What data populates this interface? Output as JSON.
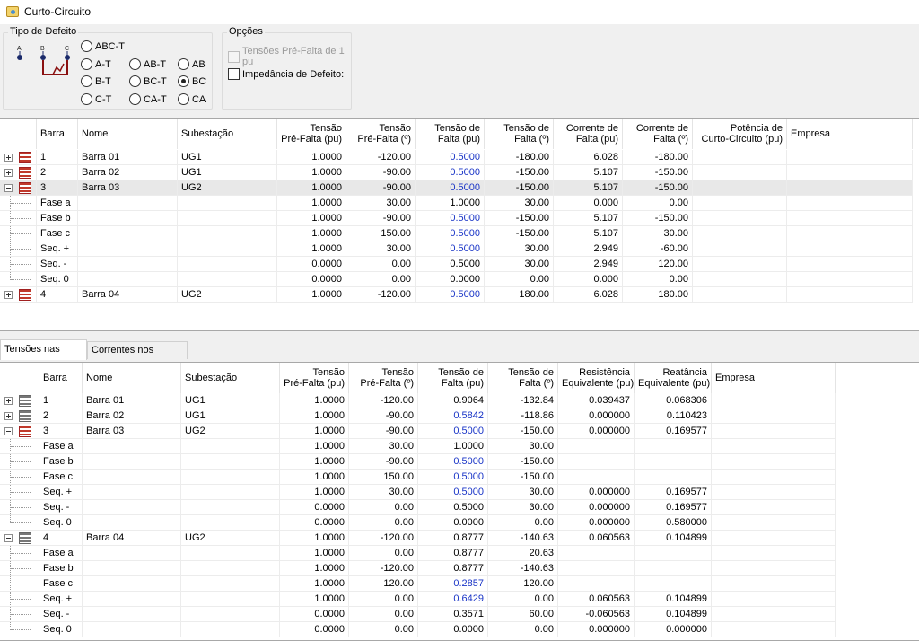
{
  "window": {
    "title": "Curto-Circuito"
  },
  "tipo_defeito": {
    "title": "Tipo de Defeito",
    "diagram_labels": [
      "A",
      "B",
      "C"
    ],
    "options": [
      {
        "label": "ABC-T",
        "checked": false
      },
      {
        "label": "A-T",
        "checked": false
      },
      {
        "label": "AB-T",
        "checked": false
      },
      {
        "label": "AB",
        "checked": false
      },
      {
        "label": "B-T",
        "checked": false
      },
      {
        "label": "BC-T",
        "checked": false
      },
      {
        "label": "BC",
        "checked": true
      },
      {
        "label": "C-T",
        "checked": false
      },
      {
        "label": "CA-T",
        "checked": false
      },
      {
        "label": "CA",
        "checked": false
      }
    ]
  },
  "opcoes": {
    "title": "Opções",
    "tensoes_prefalta": {
      "label": "Tensões Pré-Falta de 1 pu",
      "checked": false,
      "enabled": false
    },
    "impedancia": {
      "label": "Impedância de Defeito:",
      "checked": false,
      "enabled": true
    }
  },
  "grid1": {
    "headers": [
      [
        "",
        ""
      ],
      [
        "",
        "Barra"
      ],
      [
        "",
        "Nome"
      ],
      [
        "",
        "Subestação"
      ],
      [
        "Tensão",
        "Pré-Falta (pu)"
      ],
      [
        "Tensão",
        "Pré-Falta (º)"
      ],
      [
        "Tensão de",
        "Falta (pu)"
      ],
      [
        "Tensão de",
        "Falta (º)"
      ],
      [
        "Corrente de",
        "Falta (pu)"
      ],
      [
        "Corrente de",
        "Falta (º)"
      ],
      [
        "Potência de",
        "Curto-Circuito (pu)"
      ],
      [
        "",
        "Empresa"
      ]
    ],
    "rows": [
      {
        "type": "bus",
        "expander": "plus",
        "icon": "red",
        "cells": [
          "1",
          "Barra 01",
          "UG1",
          "1.0000",
          "-120.00",
          "0.5000",
          "-180.00",
          "6.028",
          "-180.00",
          "",
          ""
        ],
        "blue": [
          5
        ]
      },
      {
        "type": "bus",
        "expander": "plus",
        "icon": "red",
        "cells": [
          "2",
          "Barra 02",
          "UG1",
          "1.0000",
          "-90.00",
          "0.5000",
          "-150.00",
          "5.107",
          "-150.00",
          "",
          ""
        ],
        "blue": [
          5
        ]
      },
      {
        "type": "bus",
        "expander": "minus",
        "icon": "red",
        "selected": true,
        "cells": [
          "3",
          "Barra 03",
          "UG2",
          "1.0000",
          "-90.00",
          "0.5000",
          "-150.00",
          "5.107",
          "-150.00",
          "",
          ""
        ],
        "blue": [
          5
        ]
      },
      {
        "type": "child",
        "cells": [
          "Fase a",
          "",
          "",
          "1.0000",
          "30.00",
          "1.0000",
          "30.00",
          "0.000",
          "0.00",
          "",
          ""
        ],
        "blue": []
      },
      {
        "type": "child",
        "cells": [
          "Fase b",
          "",
          "",
          "1.0000",
          "-90.00",
          "0.5000",
          "-150.00",
          "5.107",
          "-150.00",
          "",
          ""
        ],
        "blue": [
          5
        ]
      },
      {
        "type": "child",
        "cells": [
          "Fase c",
          "",
          "",
          "1.0000",
          "150.00",
          "0.5000",
          "-150.00",
          "5.107",
          "30.00",
          "",
          ""
        ],
        "blue": [
          5
        ]
      },
      {
        "type": "child",
        "cells": [
          "Seq. +",
          "",
          "",
          "1.0000",
          "30.00",
          "0.5000",
          "30.00",
          "2.949",
          "-60.00",
          "",
          ""
        ],
        "blue": [
          5
        ]
      },
      {
        "type": "child",
        "cells": [
          "Seq. -",
          "",
          "",
          "0.0000",
          "0.00",
          "0.5000",
          "30.00",
          "2.949",
          "120.00",
          "",
          ""
        ],
        "blue": []
      },
      {
        "type": "child",
        "last": true,
        "cells": [
          "Seq. 0",
          "",
          "",
          "0.0000",
          "0.00",
          "0.0000",
          "0.00",
          "0.000",
          "0.00",
          "",
          ""
        ],
        "blue": []
      },
      {
        "type": "bus",
        "expander": "plus",
        "icon": "red",
        "cells": [
          "4",
          "Barra 04",
          "UG2",
          "1.0000",
          "-120.00",
          "0.5000",
          "180.00",
          "6.028",
          "180.00",
          "",
          ""
        ],
        "blue": [
          5
        ]
      }
    ]
  },
  "tabs": [
    {
      "label": "Tensões nas Barras",
      "active": true
    },
    {
      "label": "Correntes nos Circuitos",
      "active": false
    }
  ],
  "grid2": {
    "headers": [
      [
        "",
        ""
      ],
      [
        "",
        "Barra"
      ],
      [
        "",
        "Nome"
      ],
      [
        "",
        "Subestação"
      ],
      [
        "Tensão",
        "Pré-Falta (pu)"
      ],
      [
        "Tensão",
        "Pré-Falta (º)"
      ],
      [
        "Tensão de",
        "Falta (pu)"
      ],
      [
        "Tensão de",
        "Falta (º)"
      ],
      [
        "Resistência",
        "Equivalente (pu)"
      ],
      [
        "Reatância",
        "Equivalente (pu)"
      ],
      [
        "",
        "Empresa"
      ]
    ],
    "rows": [
      {
        "type": "bus",
        "expander": "plus",
        "icon": "gray",
        "cells": [
          "1",
          "Barra 01",
          "UG1",
          "1.0000",
          "-120.00",
          "0.9064",
          "-132.84",
          "0.039437",
          "0.068306",
          ""
        ],
        "blue": []
      },
      {
        "type": "bus",
        "expander": "plus",
        "icon": "gray",
        "cells": [
          "2",
          "Barra 02",
          "UG1",
          "1.0000",
          "-90.00",
          "0.5842",
          "-118.86",
          "0.000000",
          "0.110423",
          ""
        ],
        "blue": [
          5
        ]
      },
      {
        "type": "bus",
        "expander": "minus",
        "icon": "red",
        "cells": [
          "3",
          "Barra 03",
          "UG2",
          "1.0000",
          "-90.00",
          "0.5000",
          "-150.00",
          "0.000000",
          "0.169577",
          ""
        ],
        "blue": [
          5
        ]
      },
      {
        "type": "child",
        "cells": [
          "Fase a",
          "",
          "",
          "1.0000",
          "30.00",
          "1.0000",
          "30.00",
          "",
          "",
          ""
        ],
        "blue": []
      },
      {
        "type": "child",
        "cells": [
          "Fase b",
          "",
          "",
          "1.0000",
          "-90.00",
          "0.5000",
          "-150.00",
          "",
          "",
          ""
        ],
        "blue": [
          5
        ]
      },
      {
        "type": "child",
        "cells": [
          "Fase c",
          "",
          "",
          "1.0000",
          "150.00",
          "0.5000",
          "-150.00",
          "",
          "",
          ""
        ],
        "blue": [
          5
        ]
      },
      {
        "type": "child",
        "cells": [
          "Seq. +",
          "",
          "",
          "1.0000",
          "30.00",
          "0.5000",
          "30.00",
          "0.000000",
          "0.169577",
          ""
        ],
        "blue": [
          5
        ]
      },
      {
        "type": "child",
        "cells": [
          "Seq. -",
          "",
          "",
          "0.0000",
          "0.00",
          "0.5000",
          "30.00",
          "0.000000",
          "0.169577",
          ""
        ],
        "blue": []
      },
      {
        "type": "child",
        "last": true,
        "cells": [
          "Seq. 0",
          "",
          "",
          "0.0000",
          "0.00",
          "0.0000",
          "0.00",
          "0.000000",
          "0.580000",
          ""
        ],
        "blue": []
      },
      {
        "type": "bus",
        "expander": "minus",
        "icon": "gray",
        "cells": [
          "4",
          "Barra 04",
          "UG2",
          "1.0000",
          "-120.00",
          "0.8777",
          "-140.63",
          "0.060563",
          "0.104899",
          ""
        ],
        "blue": []
      },
      {
        "type": "child",
        "cells": [
          "Fase a",
          "",
          "",
          "1.0000",
          "0.00",
          "0.8777",
          "20.63",
          "",
          "",
          ""
        ],
        "blue": []
      },
      {
        "type": "child",
        "cells": [
          "Fase b",
          "",
          "",
          "1.0000",
          "-120.00",
          "0.8777",
          "-140.63",
          "",
          "",
          ""
        ],
        "blue": []
      },
      {
        "type": "child",
        "cells": [
          "Fase c",
          "",
          "",
          "1.0000",
          "120.00",
          "0.2857",
          "120.00",
          "",
          "",
          ""
        ],
        "blue": [
          5
        ]
      },
      {
        "type": "child",
        "cells": [
          "Seq. +",
          "",
          "",
          "1.0000",
          "0.00",
          "0.6429",
          "0.00",
          "0.060563",
          "0.104899",
          ""
        ],
        "blue": [
          5
        ]
      },
      {
        "type": "child",
        "cells": [
          "Seq. -",
          "",
          "",
          "0.0000",
          "0.00",
          "0.3571",
          "60.00",
          "-0.060563",
          "0.104899",
          ""
        ],
        "blue": []
      },
      {
        "type": "child",
        "last": true,
        "cells": [
          "Seq. 0",
          "",
          "",
          "0.0000",
          "0.00",
          "0.0000",
          "0.00",
          "0.000000",
          "0.000000",
          ""
        ],
        "blue": []
      }
    ]
  }
}
